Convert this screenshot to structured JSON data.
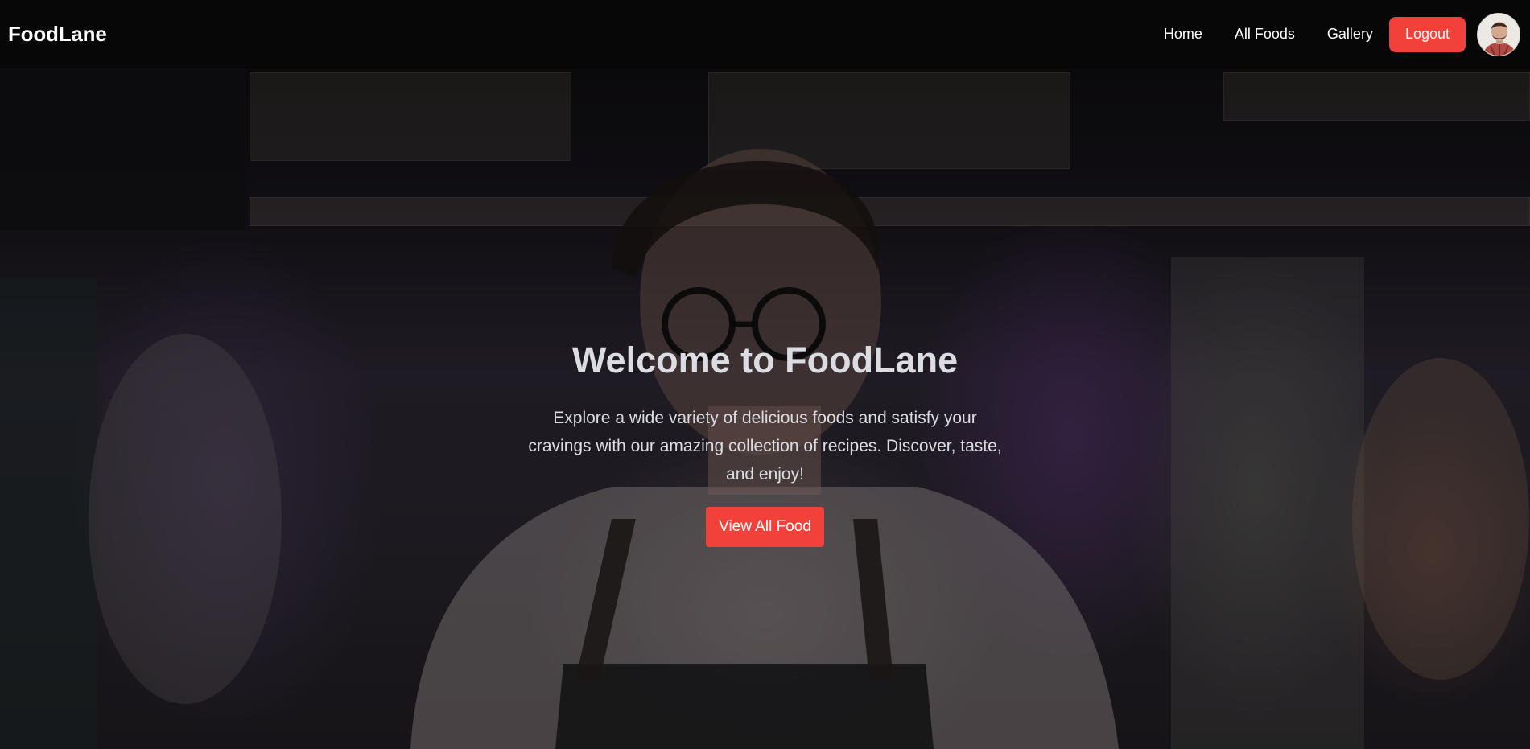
{
  "navbar": {
    "brand": "FoodLane",
    "links": [
      {
        "label": "Home"
      },
      {
        "label": "All Foods"
      },
      {
        "label": "Gallery"
      }
    ],
    "logout_label": "Logout",
    "avatar_icon": "user-avatar-icon"
  },
  "hero": {
    "title": "Welcome to FoodLane",
    "description": "Explore a wide variety of delicious foods and satisfy your cravings with our amazing collection of recipes. Discover, taste, and enjoy!",
    "cta_label": "View All Food"
  },
  "colors": {
    "accent": "#f2413b",
    "navbar_bg": "#070707",
    "text": "#dcdde2"
  }
}
